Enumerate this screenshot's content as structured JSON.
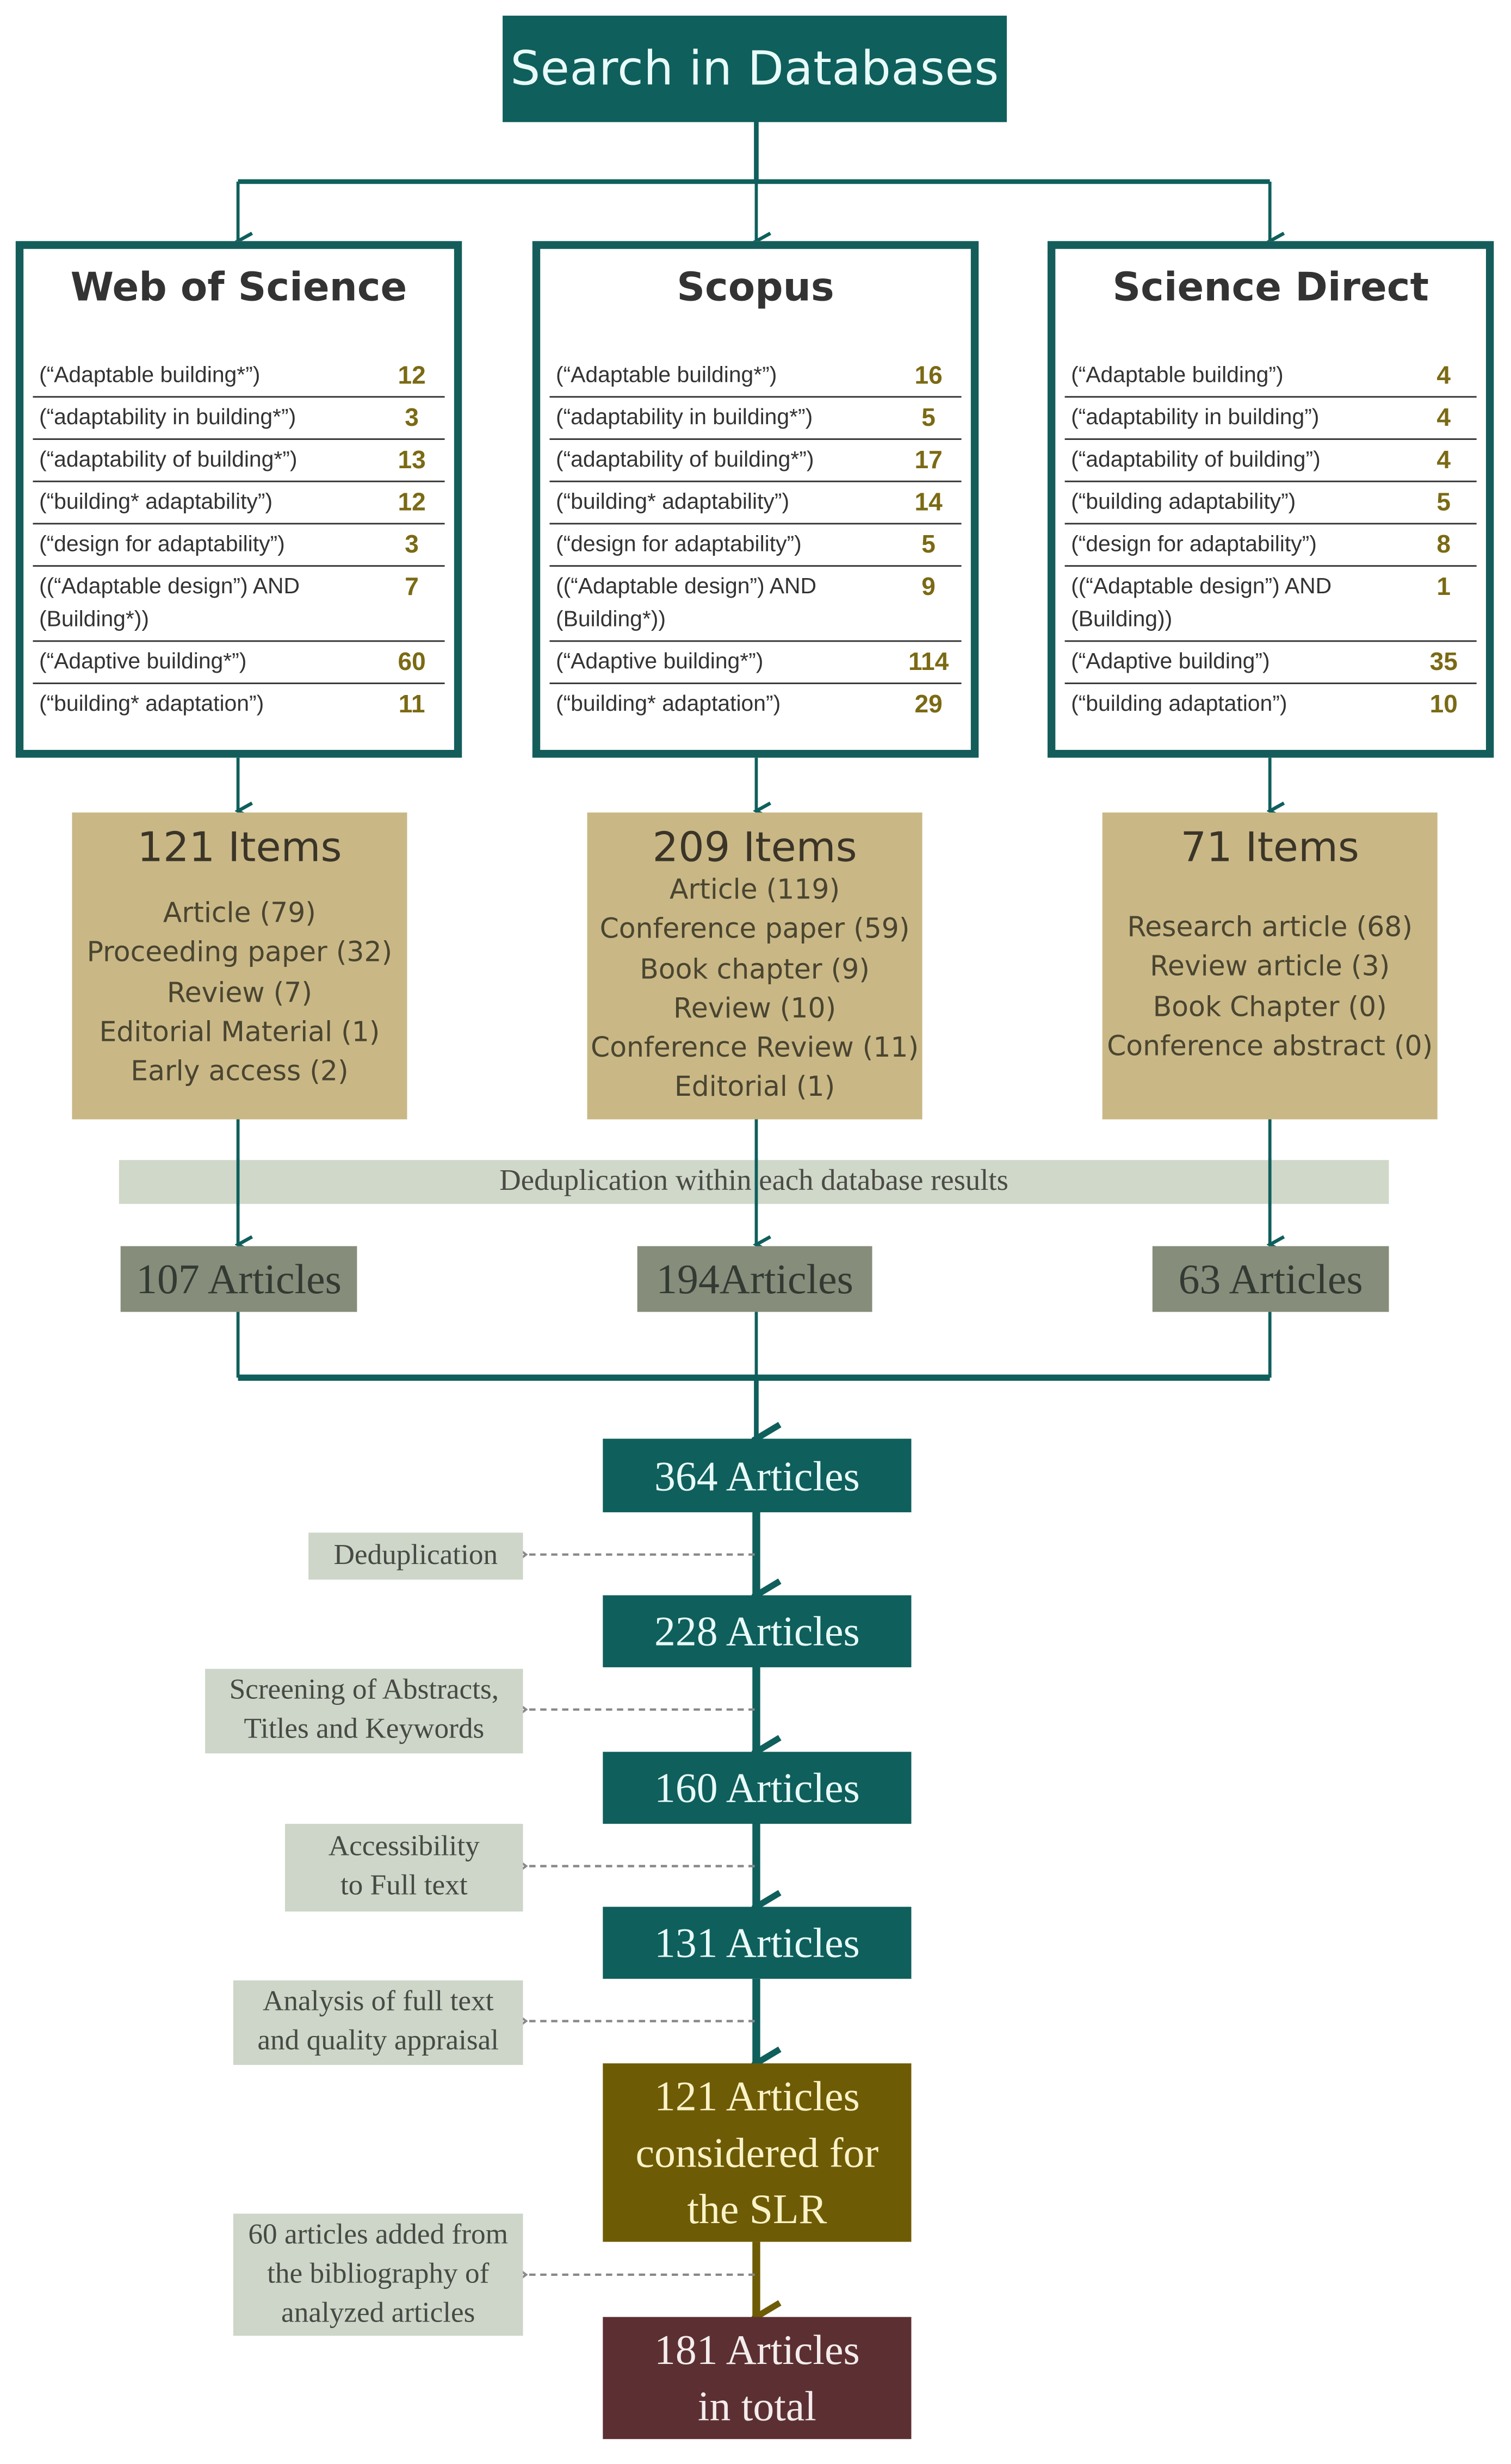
{
  "colors": {
    "teal": "#0f5f5c",
    "tan": "#c9b886",
    "olive": "#6e5b05",
    "maroon": "#5c3032",
    "grey_green": "#868d7a",
    "pale_sage": "#cdd6c8",
    "count_gold": "#7b6a14"
  },
  "root": {
    "label": "Search in Databases"
  },
  "databases": [
    {
      "name": "Web of Science",
      "queries": [
        {
          "q": "(“Adaptable building*”)",
          "n": "12"
        },
        {
          "q": "(“adaptability in building*”)",
          "n": "3"
        },
        {
          "q": "(“adaptability of building*”)",
          "n": "13"
        },
        {
          "q": "(“building* adaptability”)",
          "n": "12"
        },
        {
          "q": "(“design for adaptability”)",
          "n": "3"
        },
        {
          "q": "((“Adaptable design”) AND (Building*))",
          "n": "7"
        },
        {
          "q": "(“Adaptive building*”)",
          "n": "60"
        },
        {
          "q": "(“building* adaptation”)",
          "n": "11"
        }
      ],
      "items_title": "121 Items",
      "items": [
        "Article (79)",
        "Proceeding paper (32)",
        "Review (7)",
        "Editorial Material (1)",
        "Early access (2)"
      ],
      "deduped": "107 Articles"
    },
    {
      "name": "Scopus",
      "queries": [
        {
          "q": "(“Adaptable building*”)",
          "n": "16"
        },
        {
          "q": "(“adaptability in building*”)",
          "n": "5"
        },
        {
          "q": "(“adaptability of building*”)",
          "n": "17"
        },
        {
          "q": "(“building* adaptability”)",
          "n": "14"
        },
        {
          "q": "(“design for adaptability”)",
          "n": "5"
        },
        {
          "q": "((“Adaptable design”) AND (Building*))",
          "n": "9"
        },
        {
          "q": "(“Adaptive building*”)",
          "n": "114"
        },
        {
          "q": "(“building* adaptation”)",
          "n": "29"
        }
      ],
      "items_title": "209 Items",
      "items": [
        "Article (119)",
        "Conference paper (59)",
        "Book chapter (9)",
        "Review (10)",
        "Conference Review (11)",
        "Editorial (1)"
      ],
      "deduped": "194Articles"
    },
    {
      "name": "Science Direct",
      "queries": [
        {
          "q": "(“Adaptable building”)",
          "n": "4"
        },
        {
          "q": "(“adaptability in building”)",
          "n": "4"
        },
        {
          "q": "(“adaptability of building”)",
          "n": "4"
        },
        {
          "q": "(“building adaptability”)",
          "n": "5"
        },
        {
          "q": "(“design for adaptability”)",
          "n": "8"
        },
        {
          "q": "((“Adaptable design”) AND (Building))",
          "n": "1"
        },
        {
          "q": "(“Adaptive building”)",
          "n": "35"
        },
        {
          "q": "(“building adaptation”)",
          "n": "10"
        }
      ],
      "items_title": "71 Items",
      "items": [
        "Research article (68)",
        "Review article (3)",
        "Book Chapter (0)",
        "Conference abstract (0)"
      ],
      "deduped": "63 Articles"
    }
  ],
  "dedup_within": "Deduplication within each database results",
  "pipeline": [
    {
      "label": "364 Articles"
    },
    {
      "label": "228 Articles",
      "step": "Deduplication"
    },
    {
      "label": "160 Articles",
      "step": "Screening of Abstracts, Titles and Keywords"
    },
    {
      "label": "131 Articles",
      "step": "Accessibility to Full text"
    },
    {
      "label": "121 Articles considered for the SLR",
      "step": "Analysis of full text and quality appraisal"
    },
    {
      "label": "181 Articles in total",
      "step": "60 articles added from the bibliography of analyzed articles"
    }
  ]
}
